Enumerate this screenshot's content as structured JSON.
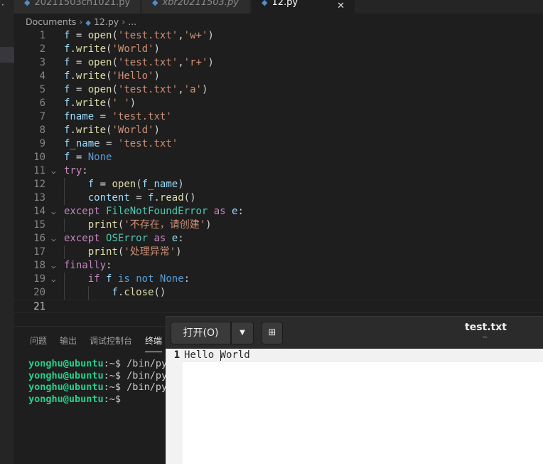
{
  "tabs": [
    {
      "label": "20211503ch1021.py",
      "active": false
    },
    {
      "label": "xbr20211503.py",
      "active": false
    },
    {
      "label": "12.py",
      "active": true
    }
  ],
  "breadcrumb": {
    "folder": "Documents",
    "file": "12.py",
    "more": "..."
  },
  "code_lines": [
    "f = open('test.txt','w+')",
    "f.write('World')",
    "f = open('test.txt','r+')",
    "f.write('Hello')",
    "f = open('test.txt','a')",
    "f.write(' ')",
    "fname = 'test.txt'",
    "f.write('World')",
    "f_name = 'test.txt'",
    "f = None",
    "try:",
    "    f = open(f_name)",
    "    content = f.read()",
    "except FileNotFoundError as e:",
    "    print('不存在，请创建')",
    "except OSError as e:",
    "    print('处理异常')",
    "finally:",
    "    if f is not None:",
    "        f.close()",
    ""
  ],
  "panel": {
    "tabs": [
      "问题",
      "输出",
      "调试控制台",
      "终端"
    ],
    "active_tab": "终端",
    "terminal": [
      {
        "user": "yonghu@ubuntu",
        "rest": ":~$ /bin/py"
      },
      {
        "user": "yonghu@ubuntu",
        "rest": ":~$ /bin/py"
      },
      {
        "user": "yonghu@ubuntu",
        "rest": ":~$ /bin/py"
      },
      {
        "user": "yonghu@ubuntu",
        "rest": ":~$"
      }
    ]
  },
  "gedit": {
    "open_label": "打开(O)",
    "title": "test.txt",
    "subtitle": "~",
    "line_number": "1",
    "content": "Hello World"
  },
  "colors": {
    "keyword": "#c586c0",
    "builtin": "#569cd6",
    "function": "#dcdcaa",
    "string": "#ce9178",
    "class": "#4ec9b0",
    "terminal_user": "#23d18b"
  }
}
